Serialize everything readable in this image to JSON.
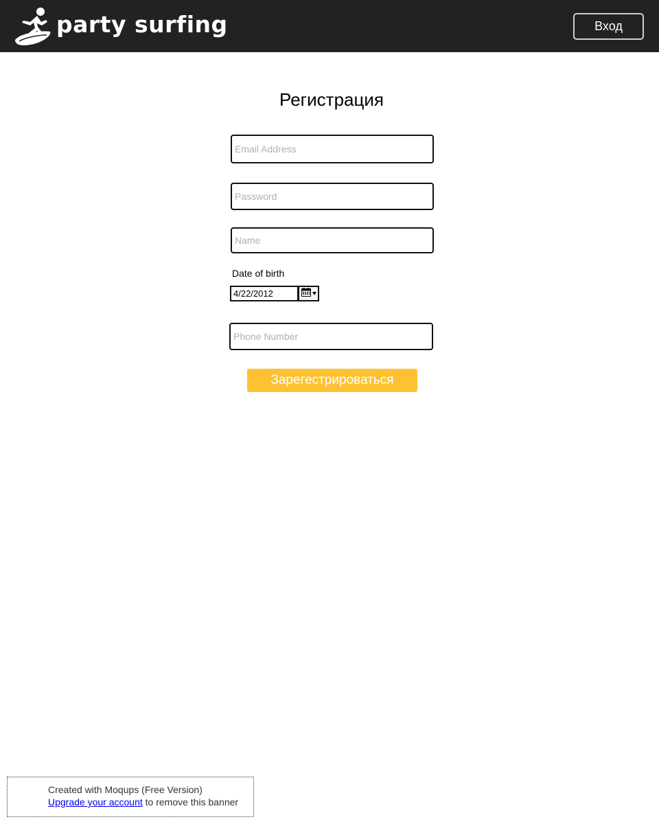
{
  "header": {
    "logo_text": "party surfing",
    "login_label": "Вход",
    "background": "#222222"
  },
  "form": {
    "title": "Регистрация",
    "email_placeholder": "Email Address",
    "password_placeholder": "Password",
    "name_placeholder": "Name",
    "dob_label": "Date of birth",
    "dob_value": "4/22/2012",
    "phone_placeholder": "Phone Number",
    "submit_label": "Зарегестрироваться",
    "submit_color": "#fdc233"
  },
  "banner": {
    "line1": "Created with Moqups (Free Version)",
    "link_text": "Upgrade your account",
    "after_link": " to remove this banner"
  },
  "icons": {
    "logo": "surfer-icon",
    "date_picker": "calendar-icon"
  }
}
